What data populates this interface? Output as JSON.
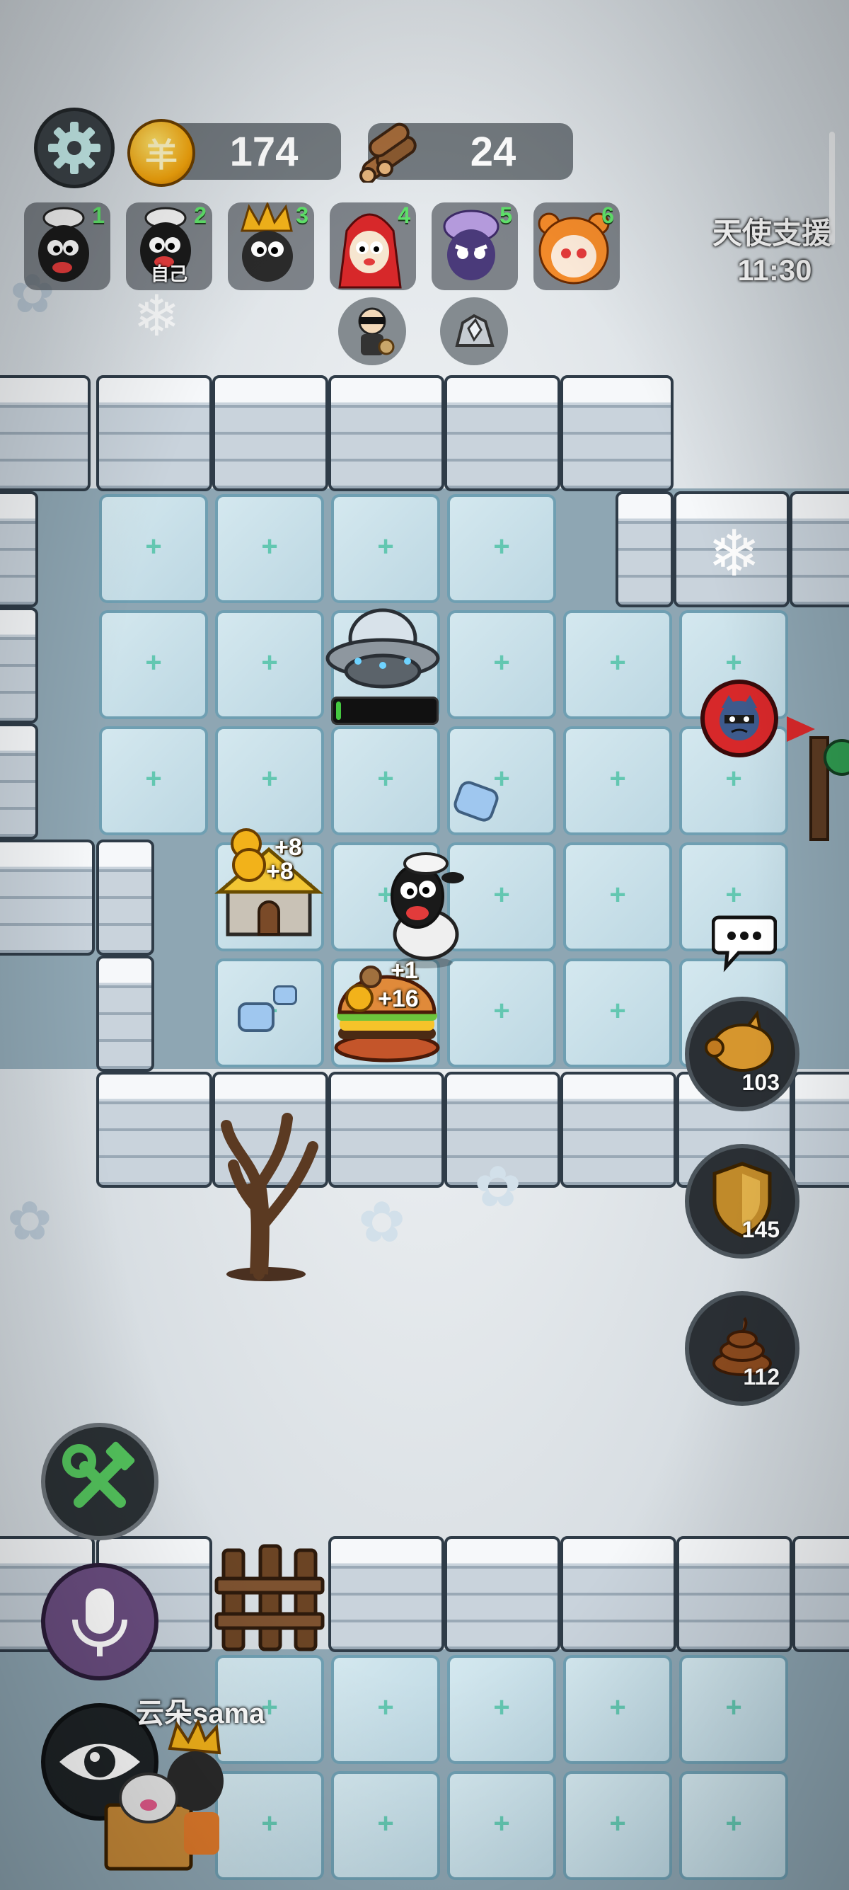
{
  "hud": {
    "settings_icon": "gear-icon",
    "coins": "174",
    "coin_icon": "coin-icon",
    "coin_glyph": "羊",
    "wood": "24",
    "wood_icon": "logs-icon"
  },
  "players": [
    {
      "number": "1",
      "tag": "",
      "avatar": "black-sheep-chef"
    },
    {
      "number": "2",
      "tag": "自己",
      "avatar": "black-sheep-chef"
    },
    {
      "number": "3",
      "tag": "",
      "avatar": "spiky-hair-sheep"
    },
    {
      "number": "4",
      "tag": "",
      "avatar": "red-hood-sheep"
    },
    {
      "number": "5",
      "tag": "",
      "avatar": "purple-sheep"
    },
    {
      "number": "6",
      "tag": "",
      "avatar": "tiger-costume-sheep"
    }
  ],
  "badges": [
    "thief-icon",
    "ore-icon"
  ],
  "angel_support": {
    "label": "天使支援",
    "timer": "11:30"
  },
  "map": {
    "ufo_progress": 0.05,
    "house_gain_1": "+8",
    "house_gain_2": "+8",
    "burger_gain_1": "+1",
    "burger_gain_2": "+16"
  },
  "side_buttons": [
    {
      "icon": "piggy-bank-icon",
      "count": "103"
    },
    {
      "icon": "shield-icon",
      "count": "145"
    },
    {
      "icon": "poop-icon",
      "count": "112"
    }
  ],
  "tools": {
    "build_icon": "hammer-wrench-icon",
    "mic_icon": "microphone-icon",
    "view_icon": "eye-icon",
    "chat_icon": "chat-bubble-icon"
  },
  "username": "云朵sama",
  "colors": {
    "accent_green": "#5fe06a",
    "gold": "#f0a20c",
    "enemy_red": "#d7282a"
  }
}
